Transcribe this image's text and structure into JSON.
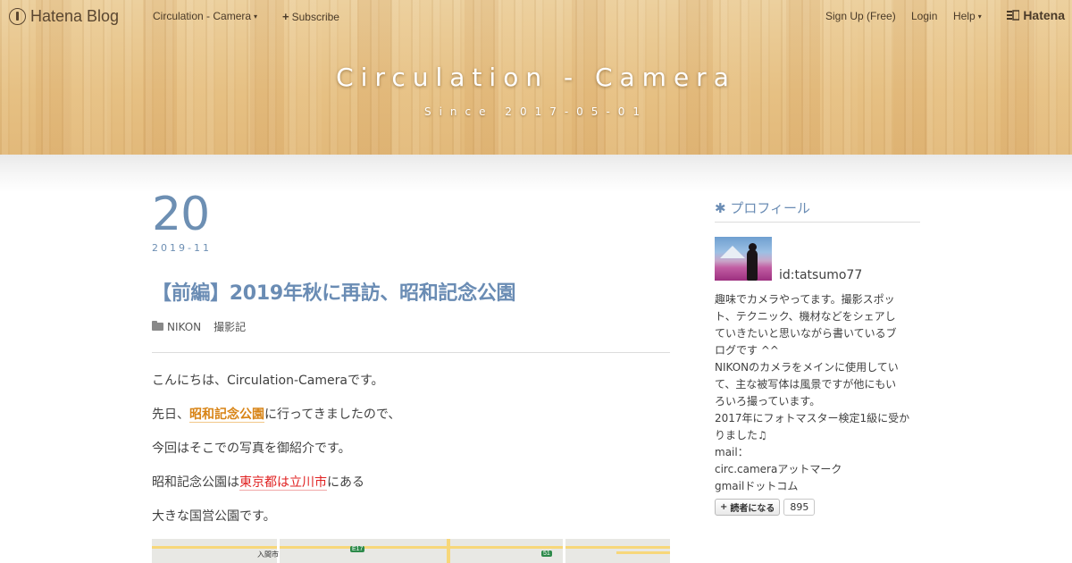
{
  "topbar": {
    "brand": "Hatena Blog",
    "blog_menu": "Circulation - Camera",
    "subscribe": "Subscribe",
    "signup": "Sign Up (Free)",
    "login": "Login",
    "help": "Help",
    "hatena": "Hatena"
  },
  "header": {
    "title": "Circulation - Camera",
    "subtitle": "Since 2017-05-01"
  },
  "entry": {
    "day": "20",
    "year_month": "2019-11",
    "title": "【前編】2019年秋に再訪、昭和記念公園",
    "categories": [
      "NIKON",
      "撮影記"
    ],
    "p1": "こんにちは、Circulation-Cameraです。",
    "p2_before": "先日、",
    "p2_link": "昭和記念公園",
    "p2_after": "に行ってきましたので、",
    "p3": "今回はそこでの写真を御紹介です。",
    "p4_before": "昭和記念公園は",
    "p4_highlight": "東京都は立川市",
    "p4_after": "にある",
    "p5": "大きな国営公園です。",
    "map_label": "入間市",
    "map_badge1": "E17",
    "map_badge2": "51"
  },
  "sidebar": {
    "profile_title": "プロフィール",
    "user_id": "id:tatsumo77",
    "desc_lines": [
      "趣味でカメラやってます。撮影スポッ",
      "ト、テクニック、機材などをシェアし",
      "ていきたいと思いながら書いているブ",
      "ログです ^^",
      "NIKONのカメラをメインに使用してい",
      "て、主な被写体は風景ですが他にもい",
      "ろいろ撮っています。",
      "2017年にフォトマスター検定1級に受か",
      "りました♫",
      "mail：",
      "circ.cameraアットマーク",
      "gmailドットコム"
    ],
    "subscribe_label": "読者になる",
    "subscribe_count": "895"
  },
  "colors": {
    "accent_blue": "#6a8cb4",
    "highlight_orange": "#d88416",
    "highlight_red": "#e02020",
    "header_wood": "#e9c78f"
  }
}
